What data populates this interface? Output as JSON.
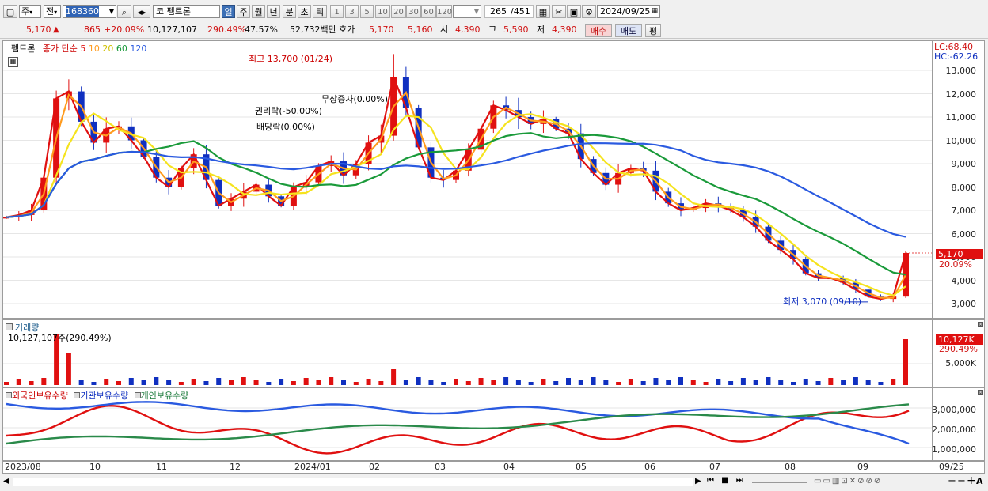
{
  "toolbar": {
    "market_type": "주",
    "prev_label": "전",
    "code": "168360",
    "name_prefix": "코",
    "stock_name": "펨트론",
    "periods": [
      "일",
      "주",
      "월",
      "년",
      "분",
      "초",
      "틱"
    ],
    "intervals": [
      "1",
      "3",
      "5",
      "10",
      "20",
      "30",
      "60",
      "120"
    ],
    "count": "265",
    "total": "/451",
    "date": "2024/09/25"
  },
  "quote": {
    "price": "5,170",
    "arrow": "▲",
    "change": "865",
    "change_pct": "+20.09%",
    "volume": "10,127,107",
    "volume_pct": "290.49%",
    "turnover_pct": "47.57%",
    "amount": "52,732백만",
    "bid_label": "호가",
    "ask": "5,170",
    "bid": "5,160",
    "open_label": "시",
    "open": "4,390",
    "high_label": "고",
    "high": "5,590",
    "low_label": "저",
    "low": "4,390",
    "buy_label": "매수",
    "sell_label": "매도",
    "eval_label": "평"
  },
  "price_panel": {
    "stock": "펨트론",
    "ma_title": "종가 단순",
    "ma_periods": [
      "5",
      "10",
      "20",
      "60",
      "120"
    ],
    "ma_colors": [
      "#e01010",
      "#ff9b1e",
      "#f5e31e",
      "#1a9a3a",
      "#2a5ae0"
    ],
    "lc": "LC:68.40",
    "hc": "HC:-62.26",
    "price_ticks": [
      "13,000",
      "12,000",
      "11,000",
      "10,000",
      "9,000",
      "8,000",
      "7,000",
      "6,000",
      "5,000",
      "4,000",
      "3,000"
    ],
    "current_price": "5,170",
    "current_pct": "20.09%",
    "annotations": {
      "high": "최고 13,700 (01/24)",
      "free_issue": "무상증자(0.00%)",
      "rights": "권리락(-50.00%)",
      "dividend": "배당락(0.00%)",
      "low": "최저 3,070 (09/10)"
    }
  },
  "volume_panel": {
    "title": "거래량",
    "info": "10,127,107주(290.49%)",
    "current": "10,127K",
    "current_pct": "290.49%",
    "tick": "5,000K"
  },
  "holding_panel": {
    "legend": [
      "외국인보유수량",
      "기관보유수량",
      "개인보유수량"
    ],
    "ticks": [
      "3,000,000",
      "2,000,000",
      "1,000,000"
    ]
  },
  "x_axis": {
    "labels": [
      "2023/08",
      "10",
      "11",
      "12",
      "2024/01",
      "02",
      "03",
      "04",
      "05",
      "06",
      "07",
      "08",
      "09"
    ],
    "right_label": "09/25"
  },
  "chart_data": {
    "type": "candlestick",
    "title": "펨트론",
    "x_range": [
      "2023/08",
      "2024/09/25"
    ],
    "ylim": [
      2700,
      13700
    ],
    "high": {
      "value": 13700,
      "date": "01/24"
    },
    "low": {
      "value": 3070,
      "date": "09/10"
    },
    "last": {
      "value": 5170,
      "change_pct": 20.09
    },
    "close_approx": [
      6700,
      6800,
      7000,
      8400,
      11800,
      12100,
      10800,
      9900,
      10500,
      10600,
      10000,
      9300,
      8400,
      8000,
      8800,
      9400,
      8300,
      7200,
      7500,
      7800,
      8100,
      7600,
      7200,
      8000,
      8200,
      8900,
      9100,
      8500,
      9000,
      9900,
      10200,
      12700,
      11400,
      9700,
      8400,
      8300,
      8700,
      9600,
      10500,
      11500,
      11300,
      11000,
      10700,
      10900,
      10500,
      10300,
      9200,
      8600,
      8100,
      8600,
      8800,
      8700,
      7800,
      7300,
      7000,
      7100,
      7300,
      7200,
      7000,
      6700,
      6300,
      5700,
      5300,
      4900,
      4300,
      4100,
      4100,
      3900,
      3600,
      3300,
      3200,
      3300,
      5170
    ],
    "volume_current": 10127107,
    "volume_pct": 290.49,
    "holdings_series": [
      {
        "name": "외국인보유수량",
        "color": "#e01010"
      },
      {
        "name": "기관보유수량",
        "color": "#2a5ae0"
      },
      {
        "name": "개인보유수량",
        "color": "#2a8a4a"
      }
    ]
  }
}
